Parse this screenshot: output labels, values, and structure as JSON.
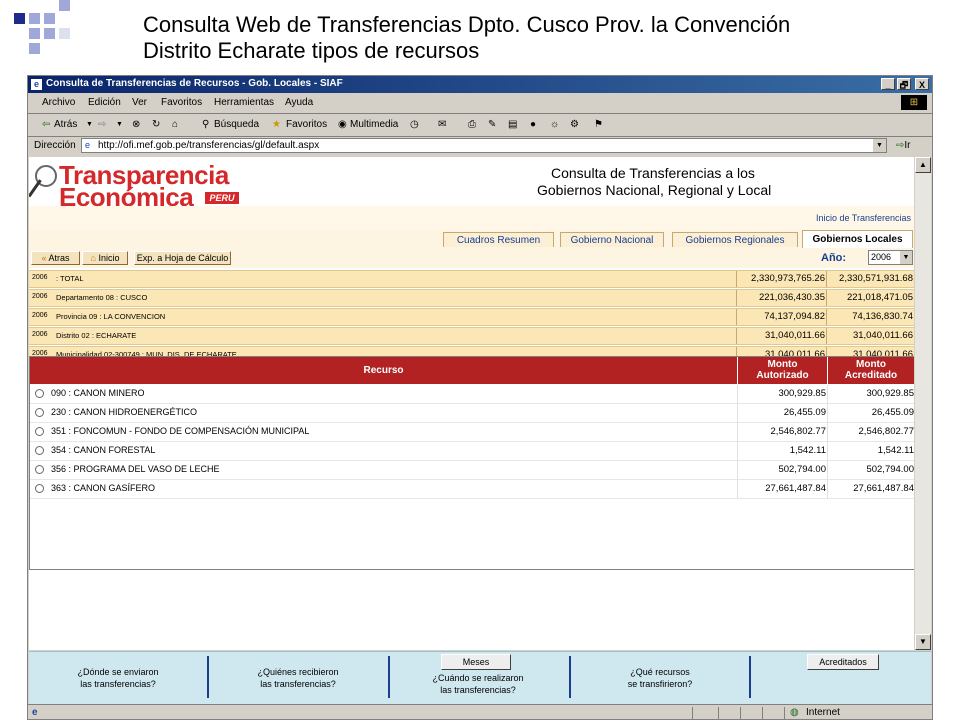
{
  "slide": {
    "title_line1": "Consulta Web de Transferencias Dpto. Cusco Prov. la Convención",
    "title_line2": "Distrito Echarate tipos de recursos",
    "accent_color": "#1f2a8c",
    "accent_light": "#9fa8d8"
  },
  "window": {
    "title": "Consulta de Transferencias de Recursos - Gob. Locales - SIAF",
    "controls": [
      "_",
      "🗗",
      "X"
    ]
  },
  "menubar": {
    "items": [
      "Archivo",
      "Edición",
      "Ver",
      "Favoritos",
      "Herramientas",
      "Ayuda"
    ]
  },
  "toolbar": {
    "back": "Atrás",
    "search": "Búsqueda",
    "favorites": "Favoritos",
    "multimedia": "Multimedia"
  },
  "address": {
    "label": "Dirección",
    "url": "http://ofi.mef.gob.pe/transferencias/gl/default.aspx",
    "go": "Ir"
  },
  "page": {
    "logo_line1": "Transparencia",
    "logo_line2": "Económica",
    "logo_badge": "PERU",
    "heading_line1": "Consulta de Transferencias a los",
    "heading_line2": "Gobiernos Nacional, Regional y Local",
    "inicio_link": "Inicio de Transferencias",
    "tabs": [
      "Cuadros Resumen",
      "Gobierno Nacional",
      "Gobiernos Regionales",
      "Gobiernos Locales"
    ],
    "active_tab": "Gobiernos Locales",
    "buttons": {
      "back": "Atras",
      "home": "Inicio",
      "export": "Exp. a Hoja de Cálculo"
    },
    "year_label": "Año:",
    "year_value": "2006"
  },
  "summary": [
    {
      "year": "2006",
      "name": ": TOTAL",
      "autorizado": "2,330,973,765.26",
      "acreditado": "2,330,571,931.68"
    },
    {
      "year": "2006",
      "name": "Departamento 08 : CUSCO",
      "autorizado": "221,036,430.35",
      "acreditado": "221,018,471.05"
    },
    {
      "year": "2006",
      "name": "Provincia 09 : LA CONVENCION",
      "autorizado": "74,137,094.82",
      "acreditado": "74,136,830.74"
    },
    {
      "year": "2006",
      "name": "Distrito 02 : ECHARATE",
      "autorizado": "31,040,011.66",
      "acreditado": "31,040,011.66"
    },
    {
      "year": "2006",
      "name": "Municipalidad 02-300749 : MUN. DIS. DE ECHARATE",
      "autorizado": "31,040,011.66",
      "acreditado": "31,040,011.66"
    }
  ],
  "recursos_table": {
    "header": {
      "recurso": "Recurso",
      "autorizado_1": "Monto",
      "autorizado_2": "Autorizado",
      "acreditado_1": "Monto",
      "acreditado_2": "Acreditado"
    },
    "rows": [
      {
        "name": "090 : CANON MINERO",
        "autorizado": "300,929.85",
        "acreditado": "300,929.85"
      },
      {
        "name": "230 : CANON HIDROENERGÉTICO",
        "autorizado": "26,455.09",
        "acreditado": "26,455.09"
      },
      {
        "name": "351 : FONCOMUN - FONDO DE COMPENSACIÓN MUNICIPAL",
        "autorizado": "2,546,802.77",
        "acreditado": "2,546,802.77"
      },
      {
        "name": "354 : CANON FORESTAL",
        "autorizado": "1,542.11",
        "acreditado": "1,542.11"
      },
      {
        "name": "356 : PROGRAMA DEL VASO DE LECHE",
        "autorizado": "502,794.00",
        "acreditado": "502,794.00"
      },
      {
        "name": "363 : CANON GASÍFERO",
        "autorizado": "27,661,487.84",
        "acreditado": "27,661,487.84"
      }
    ]
  },
  "footer": {
    "q1_a": "¿Dónde se enviaron",
    "q1_b": "las transferencias?",
    "q2_a": "¿Quiénes recibieron",
    "q2_b": "las transferencias?",
    "q3_btn": "Meses",
    "q3_a": "¿Cuándo se realizaron",
    "q3_b": "las transferencias?",
    "q4_a": "¿Qué recursos",
    "q4_b": "se transfirieron?",
    "q5_btn": "Acreditados"
  },
  "statusbar": {
    "zone": "Internet"
  }
}
